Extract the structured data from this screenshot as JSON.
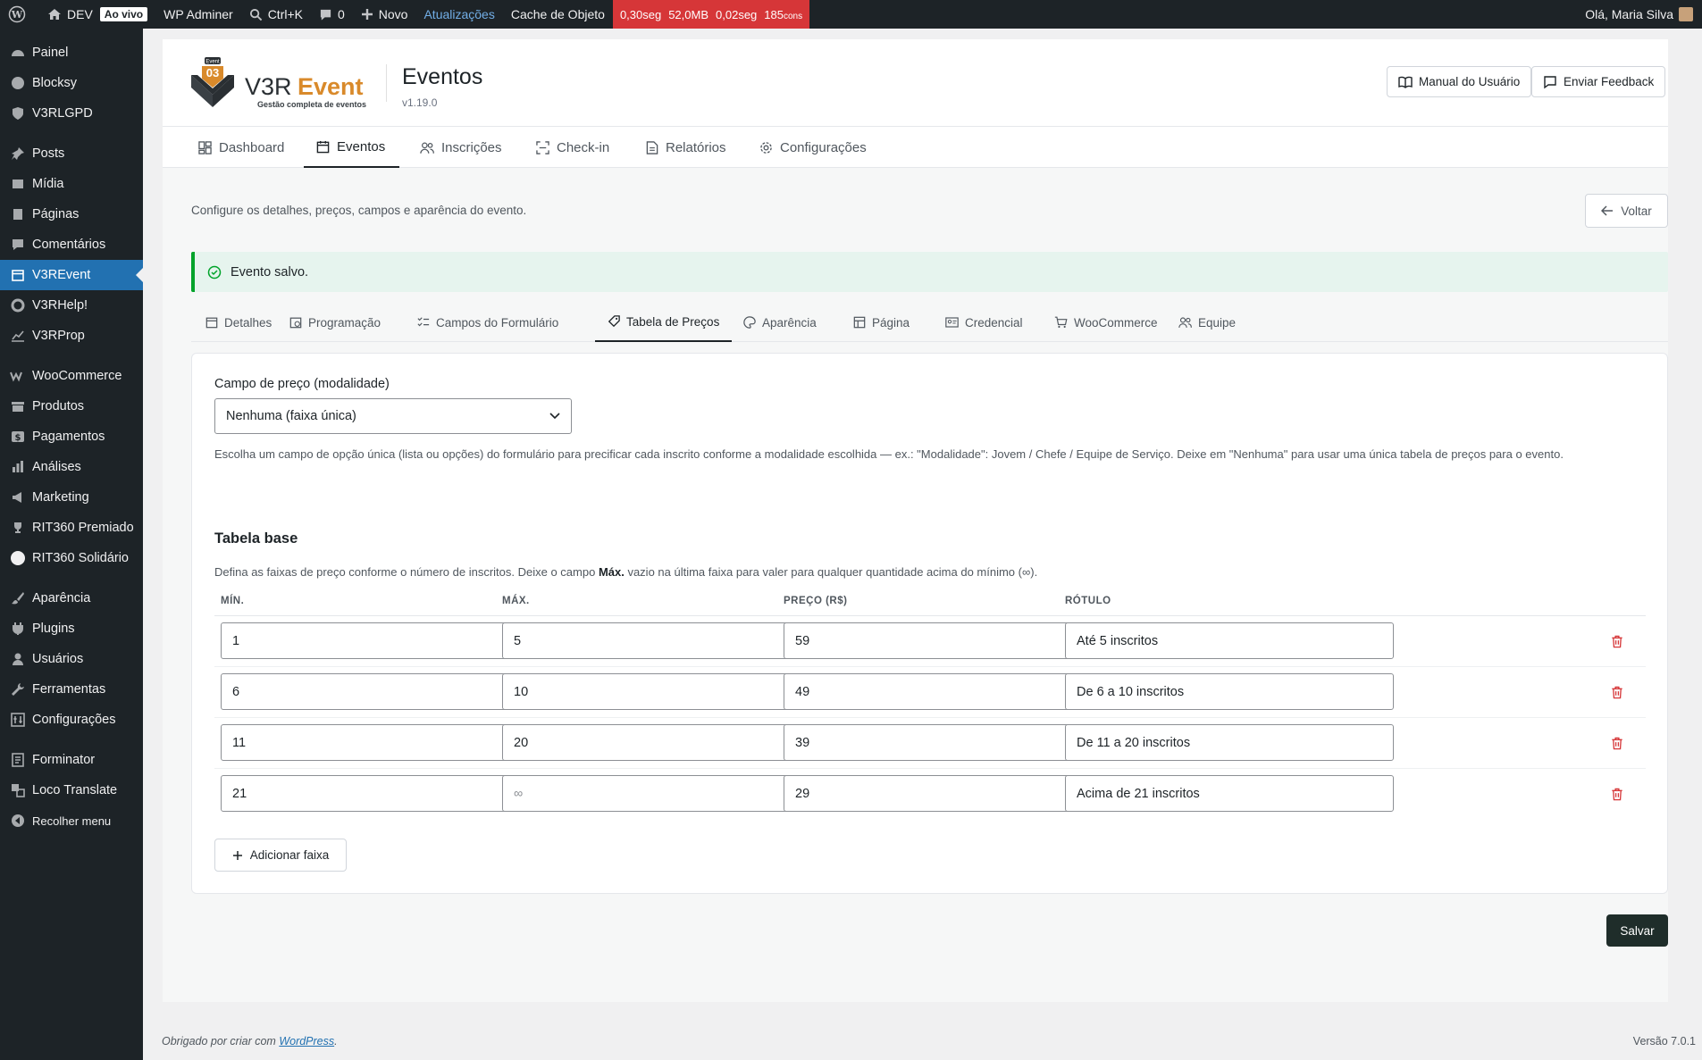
{
  "admin_bar": {
    "site_name": "DEV",
    "live_badge": "Ao vivo",
    "wp_adminer": "WP Adminer",
    "shortcut": "Ctrl+K",
    "comments_count": "0",
    "new_label": "Novo",
    "updates_label": "Atualizações",
    "object_cache": "Cache de Objeto",
    "perf_time": "0,30seg",
    "perf_memory": "52,0MB",
    "perf_query_time": "0,02seg",
    "perf_queries": "185",
    "perf_queries_unit": "cons",
    "greeting": "Olá, Maria Silva"
  },
  "sidebar": {
    "items": [
      {
        "label": "Painel",
        "icon": "dashboard-icon"
      },
      {
        "label": "Blocksy",
        "icon": "blocksy-icon"
      },
      {
        "label": "V3RLGPD",
        "icon": "shield-icon"
      },
      {
        "label": "Posts",
        "icon": "pin-icon"
      },
      {
        "label": "Mídia",
        "icon": "media-icon"
      },
      {
        "label": "Páginas",
        "icon": "pages-icon"
      },
      {
        "label": "Comentários",
        "icon": "comment-icon"
      },
      {
        "label": "V3REvent",
        "icon": "calendar-icon"
      },
      {
        "label": "V3RHelp!",
        "icon": "lifebuoy-icon"
      },
      {
        "label": "V3RProp",
        "icon": "chart-line-icon"
      },
      {
        "label": "WooCommerce",
        "icon": "woocommerce-icon"
      },
      {
        "label": "Produtos",
        "icon": "archive-icon"
      },
      {
        "label": "Pagamentos",
        "icon": "money-icon"
      },
      {
        "label": "Análises",
        "icon": "bar-chart-icon"
      },
      {
        "label": "Marketing",
        "icon": "megaphone-icon"
      },
      {
        "label": "RIT360 Premiado",
        "icon": "trophy-icon"
      },
      {
        "label": "RIT360 Solidário",
        "icon": "circle-icon"
      },
      {
        "label": "Aparência",
        "icon": "brush-icon"
      },
      {
        "label": "Plugins",
        "icon": "plug-icon"
      },
      {
        "label": "Usuários",
        "icon": "user-icon"
      },
      {
        "label": "Ferramentas",
        "icon": "wrench-icon"
      },
      {
        "label": "Configurações",
        "icon": "settings-icon"
      },
      {
        "label": "Forminator",
        "icon": "form-icon"
      },
      {
        "label": "Loco Translate",
        "icon": "translate-icon"
      },
      {
        "label": "Recolher menu",
        "icon": "collapse-icon"
      }
    ]
  },
  "header": {
    "logo_badge": "Event",
    "logo_number": "03",
    "logo_prefix": "V3R",
    "logo_suffix": "Event",
    "logo_tagline": "Gestão completa de eventos",
    "title": "Eventos",
    "version": "v1.19.0",
    "manual_button": "Manual do Usuário",
    "feedback_button": "Enviar Feedback"
  },
  "nav": {
    "tabs": [
      "Dashboard",
      "Eventos",
      "Inscrições",
      "Check-in",
      "Relatórios",
      "Configurações"
    ]
  },
  "page": {
    "intro": "Configure os detalhes, preços, campos e aparência do evento.",
    "back_button": "Voltar",
    "notice": "Evento salvo."
  },
  "subtabs": [
    "Detalhes",
    "Programação",
    "Campos do Formulário",
    "Tabela de Preços",
    "Aparência",
    "Página",
    "Credencial",
    "WooCommerce",
    "Equipe"
  ],
  "pricing": {
    "field_label": "Campo de preço (modalidade)",
    "select_value": "Nenhuma (faixa única)",
    "help": "Escolha um campo de opção única (lista ou opções) do formulário para precificar cada inscrito conforme a modalidade escolhida — ex.: \"Modalidade\": Jovem / Chefe / Equipe de Serviço. Deixe em \"Nenhuma\" para usar uma única tabela de preços para o evento.",
    "section_title": "Tabela base",
    "desc_before": "Defina as faixas de preço conforme o número de inscritos. Deixe o campo ",
    "desc_bold": "Máx.",
    "desc_after": " vazio na última faixa para valer para qualquer quantidade acima do mínimo (∞).",
    "columns": [
      "MÍN.",
      "MÁX.",
      "PREÇO (R$)",
      "RÓTULO"
    ],
    "rows": [
      {
        "min": "1",
        "max": "5",
        "price": "59",
        "label": "Até 5 inscritos"
      },
      {
        "min": "6",
        "max": "10",
        "price": "49",
        "label": "De 6 a 10 inscritos"
      },
      {
        "min": "11",
        "max": "20",
        "price": "39",
        "label": "De 11 a 20 inscritos"
      },
      {
        "min": "21",
        "max": "",
        "max_placeholder": "∞",
        "price": "29",
        "label": "Acima de 21 inscritos"
      }
    ],
    "add_button": "Adicionar faixa",
    "save_button": "Salvar"
  },
  "footer": {
    "thanks_prefix": "Obrigado por criar com ",
    "wordpress_link": "WordPress",
    "thanks_suffix": ".",
    "version": "Versão 7.0.1"
  },
  "colors": {
    "admin_dark": "#1d2327",
    "accent_blue": "#2271b1",
    "logo_orange": "#d98a2b",
    "danger_red": "#d63638",
    "success_green": "#00a32a"
  }
}
